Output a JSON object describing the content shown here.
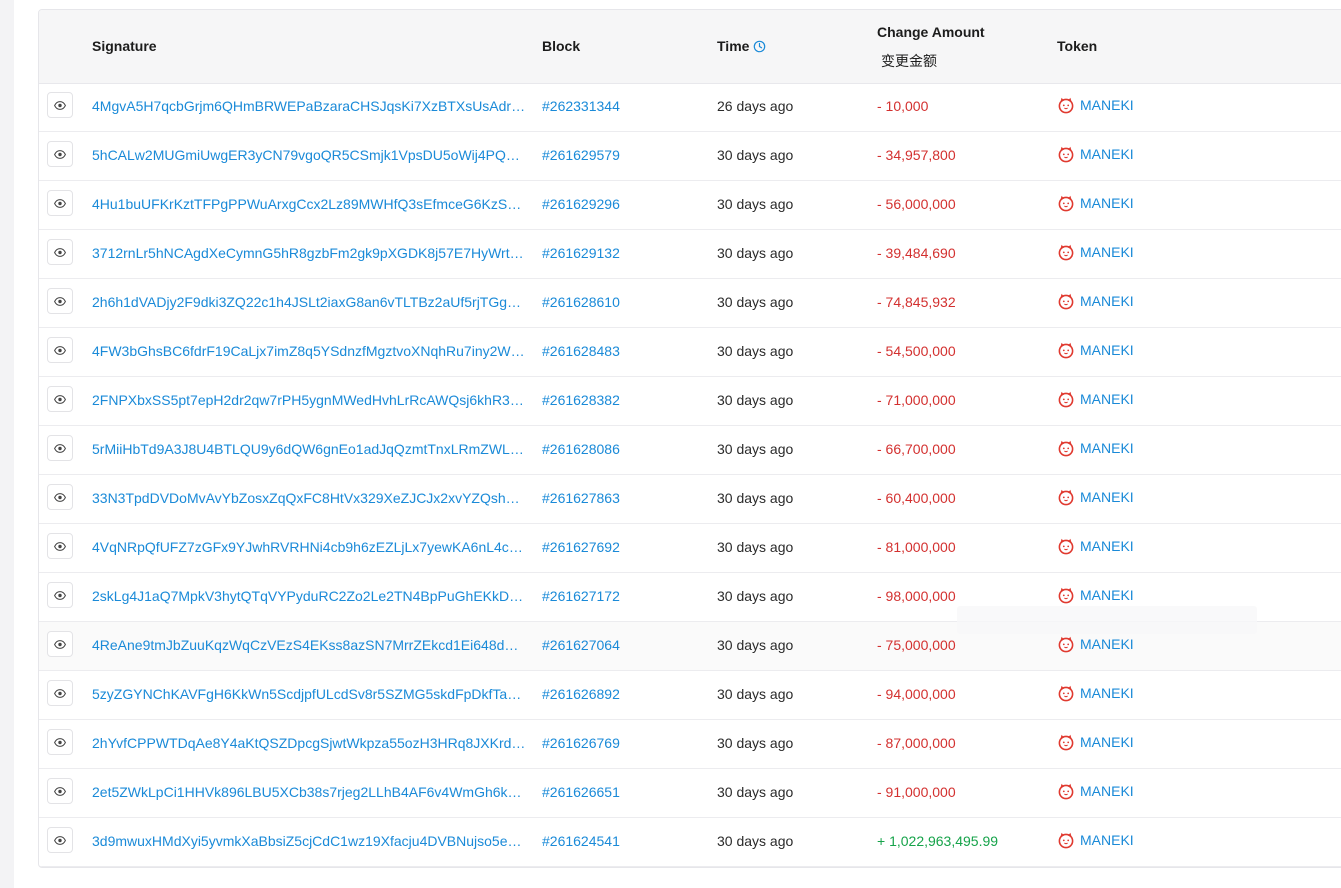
{
  "table": {
    "headers": {
      "signature": "Signature",
      "block": "Block",
      "time": "Time",
      "change_amount": "Change Amount",
      "change_amount_sub": "变更金额",
      "token": "Token"
    },
    "colors": {
      "link": "#1a8ad8",
      "negative": "#d3302f",
      "positive": "#16a34a",
      "token_logo": "#e0392f"
    },
    "rows": [
      {
        "signature": "4MgvA5H7qcbGrjm6QHmBRWEPaBzaraCHSJqsKi7XzBTXsUsAdr42…",
        "block": "#262331344",
        "time": "26 days ago",
        "amount": "- 10,000",
        "token": "MANEKI"
      },
      {
        "signature": "5hCALw2MUGmiUwgER3yCN79vgoQR5CSmjk1VpsDU5oWij4PQX2q…",
        "block": "#261629579",
        "time": "30 days ago",
        "amount": "- 34,957,800",
        "token": "MANEKI"
      },
      {
        "signature": "4Hu1buUFKrKztTFPgPPWuArxgCcx2Lz89MWHfQ3sEfmceG6KzSM…",
        "block": "#261629296",
        "time": "30 days ago",
        "amount": "- 56,000,000",
        "token": "MANEKI"
      },
      {
        "signature": "3712rnLr5hNCAgdXeCymnG5hR8gzbFm2gk9pXGDK8j57E7HyWrtCk…",
        "block": "#261629132",
        "time": "30 days ago",
        "amount": "- 39,484,690",
        "token": "MANEKI"
      },
      {
        "signature": "2h6h1dVADjy2F9dki3ZQ22c1h4JSLt2iaxG8an6vTLTBz2aUf5rjTGguZ…",
        "block": "#261628610",
        "time": "30 days ago",
        "amount": "- 74,845,932",
        "token": "MANEKI"
      },
      {
        "signature": "4FW3bGhsBC6fdrF19CaLjx7imZ8q5YSdnzfMgztvoXNqhRu7iny2Ws…",
        "block": "#261628483",
        "time": "30 days ago",
        "amount": "- 54,500,000",
        "token": "MANEKI"
      },
      {
        "signature": "2FNPXbxSS5pt7epH2dr2qw7rPH5ygnMWedHvhLrRcAWQsj6khR3yY…",
        "block": "#261628382",
        "time": "30 days ago",
        "amount": "- 71,000,000",
        "token": "MANEKI"
      },
      {
        "signature": "5rMiiHbTd9A3J8U4BTLQU9y6dQW6gnEo1adJqQzmtTnxLRmZWLE…",
        "block": "#261628086",
        "time": "30 days ago",
        "amount": "- 66,700,000",
        "token": "MANEKI"
      },
      {
        "signature": "33N3TpdDVDoMvAvYbZosxZqQxFC8HtVx329XeZJCJx2xvYZQsh8B…",
        "block": "#261627863",
        "time": "30 days ago",
        "amount": "- 60,400,000",
        "token": "MANEKI"
      },
      {
        "signature": "4VqNRpQfUFZ7zGFx9YJwhRVRHNi4cb9h6zEZLjLx7yewKA6nL4cy3…",
        "block": "#261627692",
        "time": "30 days ago",
        "amount": "- 81,000,000",
        "token": "MANEKI"
      },
      {
        "signature": "2skLg4J1aQ7MpkV3hytQTqVYPyduRC2Zo2Le2TN4BpPuGhEKkDbo…",
        "block": "#261627172",
        "time": "30 days ago",
        "amount": "- 98,000,000",
        "token": "MANEKI"
      },
      {
        "signature": "4ReAne9tmJbZuuKqzWqCzVEzS4EKss8azSN7MrrZEkcd1Ei648dCk…",
        "block": "#261627064",
        "time": "30 days ago",
        "amount": "- 75,000,000",
        "token": "MANEKI"
      },
      {
        "signature": "5zyZGYNChKAVFgH6KkWn5ScdjpfULcdSv8r5SZMG5skdFpDkfTabs…",
        "block": "#261626892",
        "time": "30 days ago",
        "amount": "- 94,000,000",
        "token": "MANEKI"
      },
      {
        "signature": "2hYvfCPPWTDqAe8Y4aKtQSZDpcgSjwtWkpza55ozH3HRq8JXKrdw…",
        "block": "#261626769",
        "time": "30 days ago",
        "amount": "- 87,000,000",
        "token": "MANEKI"
      },
      {
        "signature": "2et5ZWkLpCi1HHVk896LBU5XCb38s7rjeg2LLhB4AF6v4WmGh6kV…",
        "block": "#261626651",
        "time": "30 days ago",
        "amount": "- 91,000,000",
        "token": "MANEKI"
      },
      {
        "signature": "3d9mwuxHMdXyi5yvmkXaBbsiZ5cjCdC1wz19Xfacju4DVBNujso5e1…",
        "block": "#261624541",
        "time": "30 days ago",
        "amount": "+ 1,022,963,495.99",
        "token": "MANEKI"
      }
    ]
  }
}
